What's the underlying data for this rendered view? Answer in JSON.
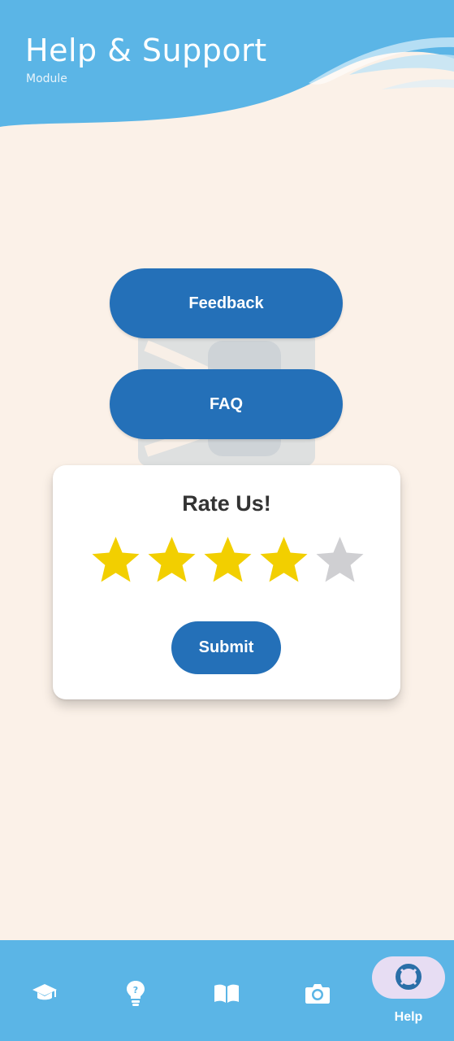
{
  "header": {
    "title": "Help & Support",
    "subtitle": "Module"
  },
  "actions": {
    "feedback_label": "Feedback",
    "faq_label": "FAQ"
  },
  "rating": {
    "title": "Rate Us!",
    "value": 4,
    "max": 5,
    "submit_label": "Submit"
  },
  "bottom_nav": {
    "items": [
      {
        "icon": "graduation-cap-icon",
        "label": "",
        "active": false
      },
      {
        "icon": "lightbulb-icon",
        "label": "",
        "active": false
      },
      {
        "icon": "book-icon",
        "label": "",
        "active": false
      },
      {
        "icon": "camera-icon",
        "label": "",
        "active": false
      },
      {
        "icon": "lifebuoy-icon",
        "label": "Help",
        "active": true
      }
    ]
  },
  "colors": {
    "background": "#fbf1e8",
    "header": "#5bb5e6",
    "primary_button": "#2470b8",
    "star_filled": "#f2cf00",
    "star_empty": "#cfcfd2",
    "active_nav_pill": "#e7ddf3"
  }
}
